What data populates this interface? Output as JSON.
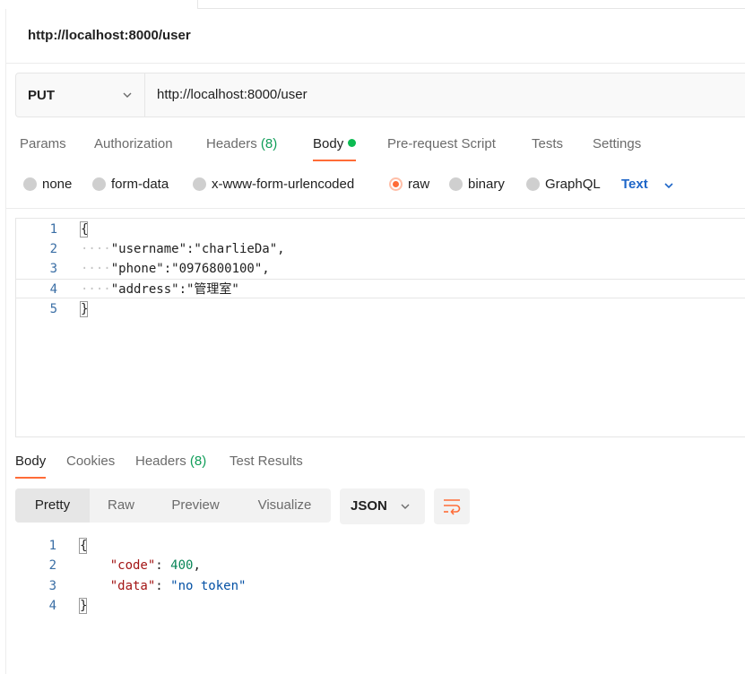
{
  "request": {
    "title": "http://localhost:8000/user",
    "method": "PUT",
    "url": "http://localhost:8000/user"
  },
  "request_tabs": [
    {
      "label": "Params"
    },
    {
      "label": "Authorization"
    },
    {
      "label": "Headers",
      "count": "(8)"
    },
    {
      "label": "Body"
    },
    {
      "label": "Pre-request Script"
    },
    {
      "label": "Tests"
    },
    {
      "label": "Settings"
    }
  ],
  "body_modes": [
    {
      "label": "none"
    },
    {
      "label": "form-data"
    },
    {
      "label": "x-www-form-urlencoded"
    },
    {
      "label": "raw"
    },
    {
      "label": "binary"
    },
    {
      "label": "GraphQL"
    }
  ],
  "raw_type": "Text",
  "request_body": {
    "line_numbers": [
      "1",
      "2",
      "3",
      "4",
      "5"
    ],
    "lines": [
      {
        "indent": "",
        "text": "{"
      },
      {
        "indent": "····",
        "text": "\"username\":\"charlieDa\","
      },
      {
        "indent": "····",
        "text": "\"phone\":\"0976800100\","
      },
      {
        "indent": "····",
        "text": "\"address\":\"管理室\""
      },
      {
        "indent": "",
        "text": "}"
      }
    ]
  },
  "response_tabs": [
    {
      "label": "Body"
    },
    {
      "label": "Cookies"
    },
    {
      "label": "Headers",
      "count": "(8)"
    },
    {
      "label": "Test Results"
    }
  ],
  "response_views": [
    {
      "label": "Pretty"
    },
    {
      "label": "Raw"
    },
    {
      "label": "Preview"
    },
    {
      "label": "Visualize"
    }
  ],
  "response_format": "JSON",
  "response_body": {
    "line_numbers": [
      "1",
      "2",
      "3",
      "4"
    ],
    "open": "{",
    "close": "}",
    "code_key": "\"code\"",
    "code_value": "400",
    "data_key": "\"data\"",
    "data_value": "\"no token\""
  },
  "colors": {
    "accent": "#ff6c37",
    "active_dot": "#0cbb52",
    "count": "#0f9d58",
    "link_blue": "#1e66c8"
  }
}
